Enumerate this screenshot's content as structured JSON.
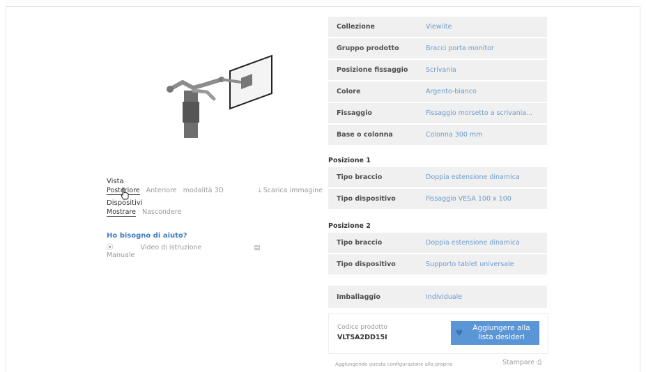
{
  "view": {
    "label": "Vista",
    "options": [
      "Posteriore",
      "Anteriore",
      "modalità 3D"
    ],
    "active_index": 0,
    "download_label": "Scarica immagine"
  },
  "devices": {
    "label": "Dispositivi",
    "options": [
      "Mostrare",
      "Nascondere"
    ],
    "active_index": 0
  },
  "help": {
    "title": "Ho bisogno di aiuto?",
    "video_label": "Video di istruzione",
    "manual_label": "Manuale"
  },
  "specs": [
    {
      "key": "Collezione",
      "value": "Viewlite"
    },
    {
      "key": "Gruppo prodotto",
      "value": "Bracci porta monitor"
    },
    {
      "key": "Posizione fissaggio",
      "value": "Scrivania"
    },
    {
      "key": "Colore",
      "value": "Argento-bianco"
    },
    {
      "key": "Fissaggio",
      "value": "Fissaggio morsetto a scrivania..."
    },
    {
      "key": "Base o colonna",
      "value": "Colonna 300 mm"
    }
  ],
  "positions": [
    {
      "title": "Posizione 1",
      "rows": [
        {
          "key": "Tipo braccio",
          "value": "Doppia estensione dinamica"
        },
        {
          "key": "Tipo dispositivo",
          "value": "Fissaggio VESA 100 x 100"
        }
      ]
    },
    {
      "title": "Posizione 2",
      "rows": [
        {
          "key": "Tipo braccio",
          "value": "Doppia estensione dinamica"
        },
        {
          "key": "Tipo dispositivo",
          "value": "Supporto tablet universale"
        }
      ]
    }
  ],
  "packaging": {
    "key": "Imballaggio",
    "value": "Individuale"
  },
  "product_code": {
    "label": "Codice prodotto",
    "value": "VLTSA2DD15I"
  },
  "wishlist_button": {
    "line1": "Aggiungere alla",
    "line2": "lista desideri"
  },
  "bottom_note": "Aggiungendo questa configurazione alla propria",
  "print_label": "Stampare",
  "colors": {
    "accent": "#5a95d6",
    "link": "#6b9bd1",
    "row_bg": "#f0f0f0"
  }
}
